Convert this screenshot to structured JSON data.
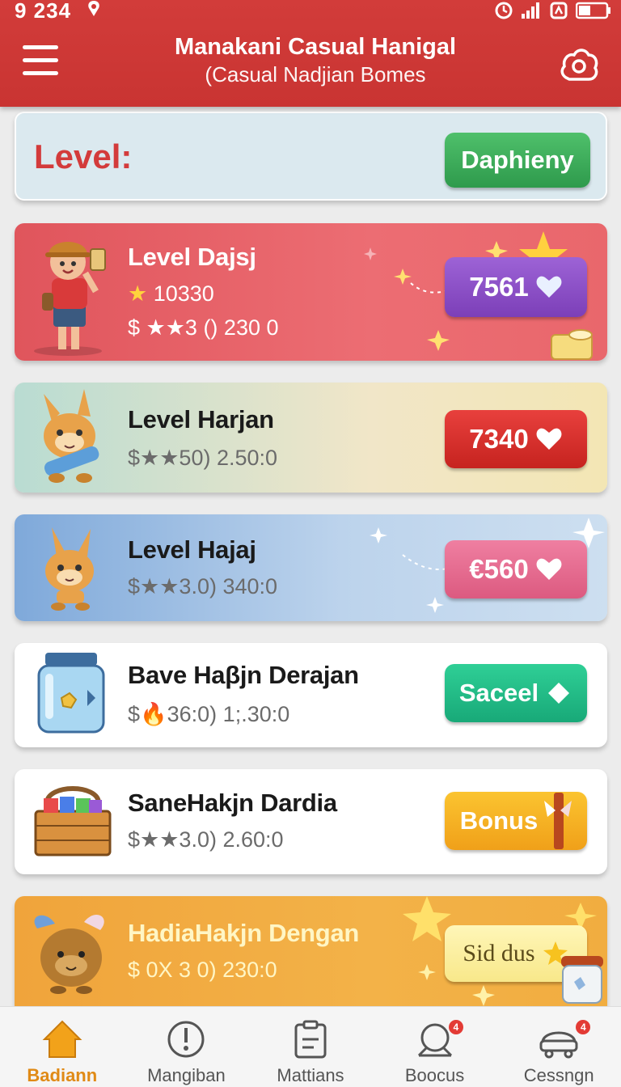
{
  "status_bar": {
    "time": "9 234"
  },
  "header": {
    "title": "Manakani Casual Hanigal",
    "subtitle": "(Casual Nadjian Bomes"
  },
  "level_header": {
    "label": "Level:",
    "button": "Daphieny"
  },
  "items": [
    {
      "title": "Level Dajsj",
      "stat_line1": "10330",
      "stats": "$ ★★3 () 230 0",
      "button": "7561",
      "button_icon": "heart-icon",
      "color": "#e0555c"
    },
    {
      "title": "Level Harjan",
      "stats": "$★★50) 2.50:0",
      "button": "7340",
      "button_icon": "heart-icon",
      "color": "#cf2d29"
    },
    {
      "title": "Level Hajaj",
      "stats": "$★★3.0) 340:0",
      "button": "€560",
      "button_icon": "heart-icon",
      "color": "#e56a8e"
    },
    {
      "title": "Bave Haβjn Derajan",
      "stats": "$🔥36:0) 1;.30:0",
      "button": "Saceel",
      "button_icon": "diamond-arrow-icon",
      "color": "#20b985"
    },
    {
      "title": "SaneHakjn Dardia",
      "stats": "$★★3.0) 2.60:0",
      "button": "Bonus",
      "button_icon": "gift-icon",
      "color": "#f5b126"
    },
    {
      "title": "HadiaHakjn Dengan",
      "stats": "$ 0X 3 0) 230:0",
      "button": "Sid dus",
      "button_icon": "star-icon",
      "color": "#f3b248"
    }
  ],
  "nav": [
    {
      "label": "Badiann",
      "icon": "home-icon",
      "active": true
    },
    {
      "label": "Mangiban",
      "icon": "alert-icon",
      "active": false
    },
    {
      "label": "Mattians",
      "icon": "clipboard-icon",
      "active": false
    },
    {
      "label": "Boocus",
      "icon": "bell-icon",
      "active": false,
      "badge": "4"
    },
    {
      "label": "Cessngn",
      "icon": "car-icon",
      "active": false,
      "badge": "4"
    }
  ]
}
